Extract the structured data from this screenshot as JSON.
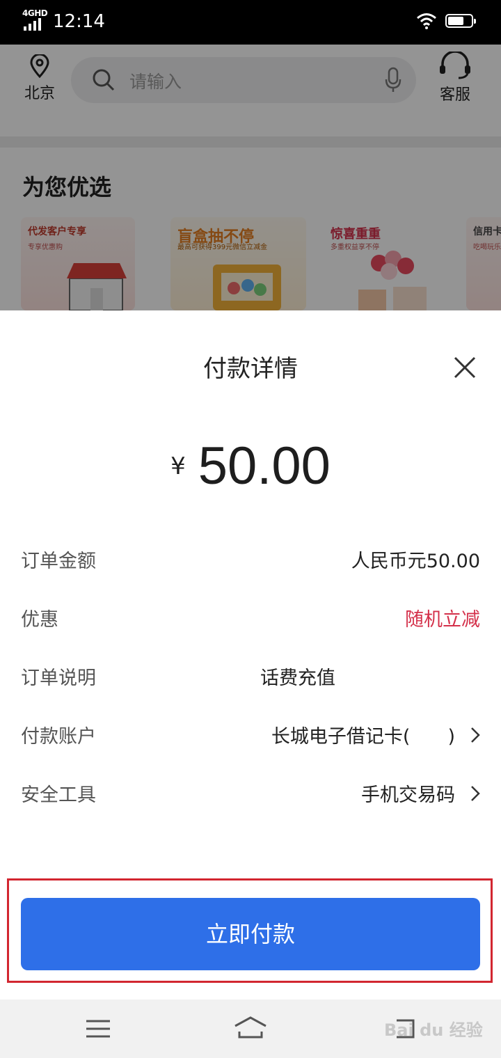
{
  "status_bar": {
    "network": "4GHD",
    "time": "12:14"
  },
  "header": {
    "location": "北京",
    "search_placeholder": "请输入",
    "service": "客服"
  },
  "recommend": {
    "title": "为您优选",
    "cards": [
      {
        "title": "代发客户专享",
        "subtitle": "专享优惠购"
      },
      {
        "title": "盲盒抽不停",
        "subtitle": "最高可获得399元微信立减金"
      },
      {
        "title": "惊喜重重",
        "subtitle": "多重权益享不停"
      },
      {
        "title": "信用卡",
        "subtitle": "吃喝玩乐"
      }
    ]
  },
  "payment": {
    "title": "付款详情",
    "currency_symbol": "¥",
    "amount": "50.00",
    "rows": [
      {
        "label": "订单金额",
        "value": "人民币元50.00"
      },
      {
        "label": "优惠",
        "value": "随机立减"
      },
      {
        "label": "订单说明",
        "value": "话费充值"
      },
      {
        "label": "付款账户",
        "value": "长城电子借记卡(　　)"
      },
      {
        "label": "安全工具",
        "value": "手机交易码"
      }
    ],
    "pay_button": "立即付款"
  },
  "watermark": "Bai du 经验"
}
